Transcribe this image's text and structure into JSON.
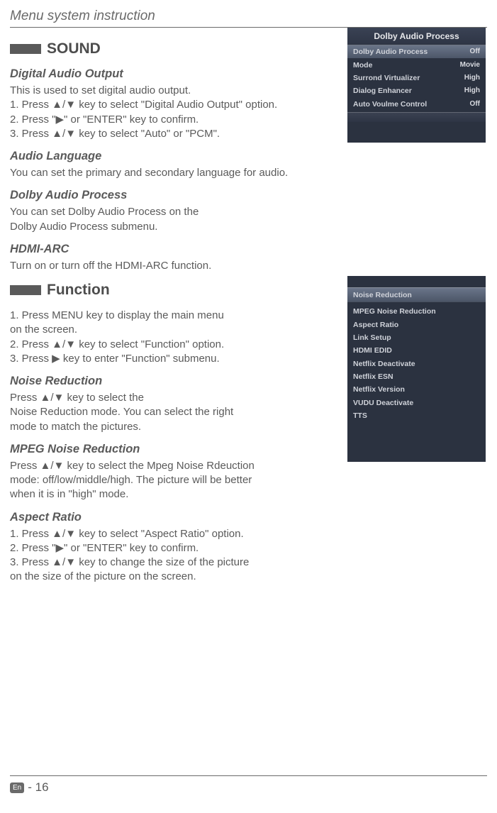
{
  "header": {
    "title": "Menu system instruction"
  },
  "sections": {
    "sound": {
      "label": "SOUND",
      "digital_audio_output": {
        "heading": "Digital Audio Output",
        "body": "This is used to  set  digital  audio  output.\n1. Press ▲/▼ key to select \"Digital  Audio  Output\" option.\n2. Press \"▶\" or \"ENTER\" key to confirm.\n3. Press ▲/▼ key to select  \"Auto\" or \"PCM\"."
      },
      "audio_language": {
        "heading": "Audio Language",
        "body": "You can set the primary and secondary language for audio."
      },
      "dolby_audio_process": {
        "heading": "Dolby Audio Process",
        "body": "You  can  set  Dolby Audio Process  on  the\nDolby Audio Process submenu."
      },
      "hdmi_arc": {
        "heading": "HDMI-ARC",
        "body": "Turn on or turn off the HDMI-ARC function."
      }
    },
    "function": {
      "label": "Function",
      "intro": "1. Press MENU key to display the main menu\n    on the screen.\n2. Press  ▲/▼ key to select \"Function\" option.\n3. Press ▶ key to enter \"Function\" submenu.",
      "noise_reduction": {
        "heading": "Noise Reduction",
        "body": "Press ▲/▼ key to select the\nNoise Reduction mode. You can select the right\nmode to match the pictures."
      },
      "mpeg_noise_reduction": {
        "heading": "MPEG Noise Reduction",
        "body": "Press ▲/▼ key to select the Mpeg Noise Rdeuction\nmode: off/low/middle/high. The picture will be better\nwhen it is in \"high\" mode."
      },
      "aspect_ratio": {
        "heading": "Aspect Ratio",
        "body": "1. Press ▲/▼ key to select \"Aspect Ratio\"  option.\n2. Press \"▶\" or \"ENTER\" key to confirm.\n3. Press ▲/▼ key to change the size of the picture\n    on the size of the picture on the screen."
      }
    }
  },
  "menus": {
    "dolby": {
      "title": "Dolby Audio Process",
      "rows": [
        {
          "label": "Dolby Audio Process",
          "value": "Off",
          "highlight": true
        },
        {
          "label": "Mode",
          "value": "Movie"
        },
        {
          "label": "Surrond  Virtualizer",
          "value": "High"
        },
        {
          "label": "Dialog  Enhancer",
          "value": "High"
        },
        {
          "label": "Auto Voulme  Control",
          "value": "Off"
        }
      ]
    },
    "function": {
      "items": [
        {
          "label": "Noise Reduction",
          "highlight": true
        },
        {
          "label": "MPEG Noise Reduction"
        },
        {
          "label": "Aspect Ratio"
        },
        {
          "label": "Link  Setup"
        },
        {
          "label": "HDMI EDID"
        },
        {
          "label": "Netflix Deactivate"
        },
        {
          "label": "Netflix ESN"
        },
        {
          "label": "Netflix Version"
        },
        {
          "label": "VUDU Deactivate"
        },
        {
          "label": "TTS"
        }
      ]
    }
  },
  "footer": {
    "lang_badge": "En",
    "page": "- 16"
  }
}
